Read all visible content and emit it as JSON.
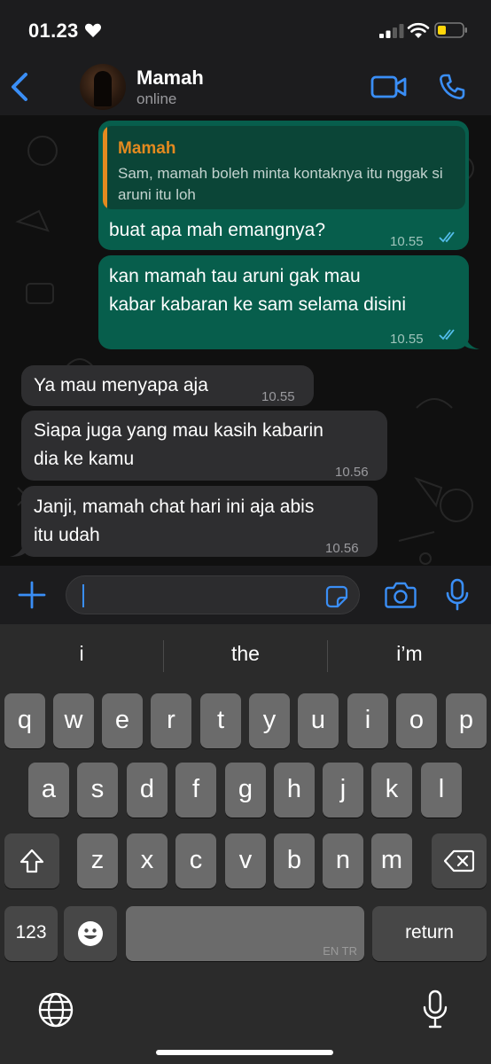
{
  "status_bar": {
    "time": "01.23"
  },
  "header": {
    "contact_name": "Mamah",
    "contact_status": "online"
  },
  "messages": [
    {
      "direction": "outgoing",
      "reply_to": {
        "name": "Mamah",
        "text": "Sam, mamah boleh minta kontaknya itu nggak si aruni itu loh"
      },
      "lines": [
        "buat apa mah emangnya?"
      ],
      "time": "10.55",
      "read": true
    },
    {
      "direction": "outgoing",
      "lines": [
        "kan mamah tau aruni gak mau",
        "kabar kabaran ke sam selama disini"
      ],
      "time": "10.55",
      "read": true
    },
    {
      "direction": "incoming",
      "lines": [
        "Ya mau menyapa aja"
      ],
      "time": "10.55"
    },
    {
      "direction": "incoming",
      "lines": [
        "Siapa juga yang mau kasih kabarin",
        "dia ke kamu"
      ],
      "time": "10.56"
    },
    {
      "direction": "incoming",
      "lines": [
        "Janji, mamah chat hari ini aja abis",
        "itu udah"
      ],
      "time": "10.56"
    }
  ],
  "input": {
    "value": ""
  },
  "keyboard": {
    "suggestions": [
      "i",
      "the",
      "i’m"
    ],
    "row1": [
      "q",
      "w",
      "e",
      "r",
      "t",
      "y",
      "u",
      "i",
      "o",
      "p"
    ],
    "row2": [
      "a",
      "s",
      "d",
      "f",
      "g",
      "h",
      "j",
      "k",
      "l"
    ],
    "row3": [
      "z",
      "x",
      "c",
      "v",
      "b",
      "n",
      "m"
    ],
    "numbers_label": "123",
    "space_language": "EN TR",
    "return_label": "return"
  },
  "colors": {
    "accent": "#3a8ef6",
    "outgoing_bubble": "#075e4c",
    "incoming_bubble": "#2e2e30",
    "reply_name": "#e48a1f"
  }
}
